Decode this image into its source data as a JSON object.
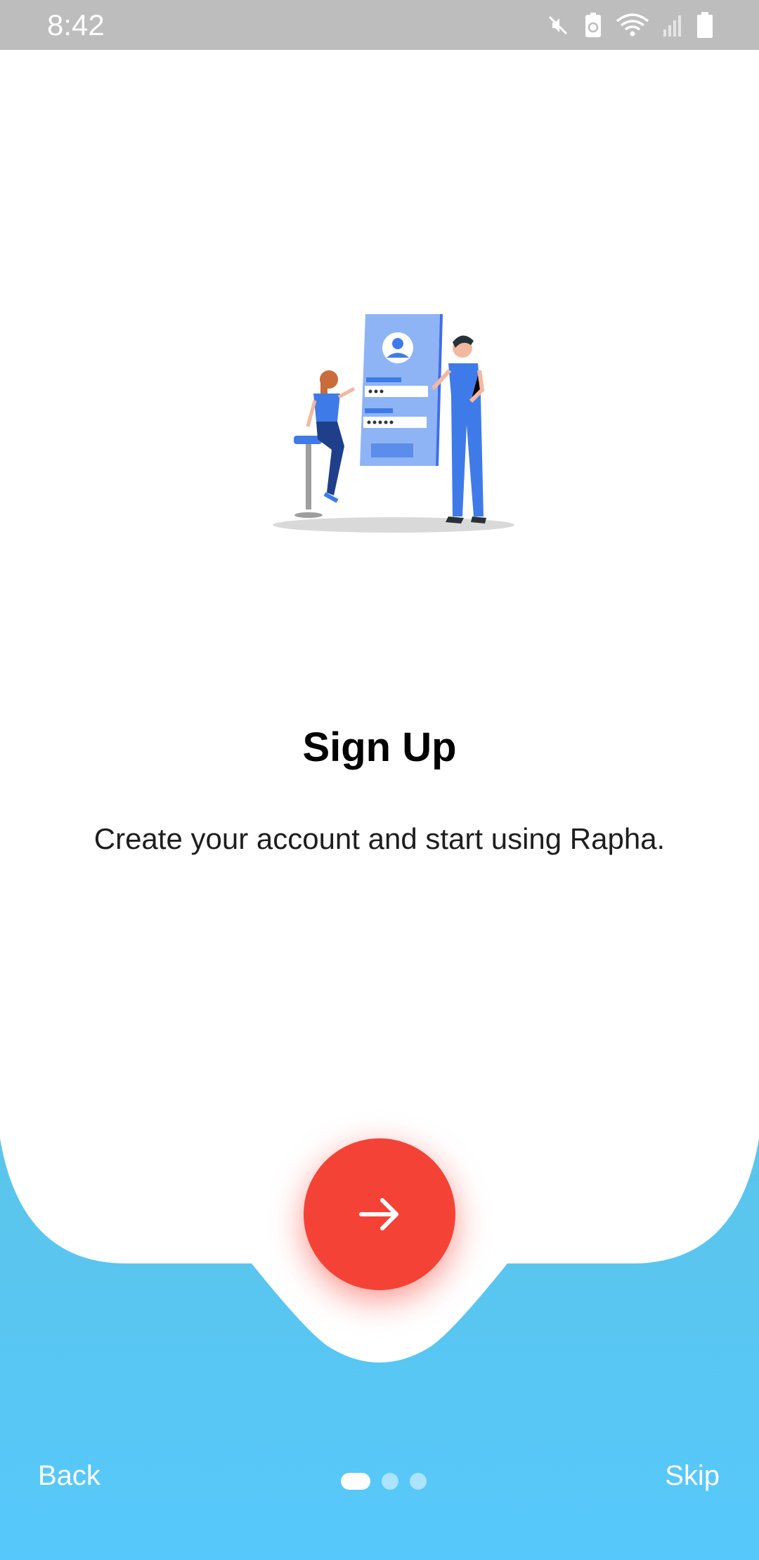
{
  "status_bar": {
    "time": "8:42",
    "icons": [
      "mute-icon",
      "data-saver-icon",
      "wifi-icon",
      "signal-icon",
      "battery-icon"
    ]
  },
  "onboarding": {
    "title": "Sign Up",
    "subtitle": "Create your account and start using Rapha.",
    "illustration": "sign-up-illustration",
    "next_icon": "arrow-right-icon"
  },
  "footer": {
    "back_label": "Back",
    "skip_label": "Skip",
    "pages": 3,
    "active_page": 1
  },
  "colors": {
    "accent": "#f44336",
    "wave_top": "#5bc5eb",
    "wave_bottom": "#56c8fb",
    "status_bar": "#bdbdbd"
  }
}
